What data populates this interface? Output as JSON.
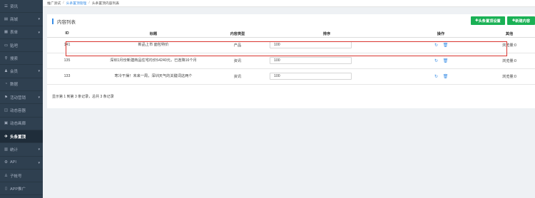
{
  "sidebar": {
    "items": [
      {
        "label": "资讯",
        "icon": "list-icon",
        "has_arrow": false
      },
      {
        "label": "商城",
        "icon": "cart-icon",
        "has_arrow": true
      },
      {
        "label": "表单",
        "icon": "form-icon",
        "has_arrow": true
      },
      {
        "label": "贴吧",
        "icon": "chat-icon",
        "has_arrow": false
      },
      {
        "label": "搜索",
        "icon": "search-icon",
        "has_arrow": false
      },
      {
        "label": "会员",
        "icon": "user-icon",
        "has_arrow": true
      },
      {
        "label": "数据",
        "icon": "chart-icon",
        "has_arrow": false
      },
      {
        "label": "活动营销",
        "icon": "flag-icon",
        "has_arrow": true
      },
      {
        "label": "动态容器",
        "icon": "box-icon",
        "has_arrow": false
      },
      {
        "label": "动态画廊",
        "icon": "gallery-icon",
        "has_arrow": false
      },
      {
        "label": "头条置顶",
        "icon": "plane-icon",
        "has_arrow": false,
        "active": true
      },
      {
        "label": "统计",
        "icon": "stats-icon",
        "has_arrow": true
      },
      {
        "label": "API",
        "icon": "api-icon",
        "has_arrow": true
      },
      {
        "label": "子帐号",
        "icon": "subaccount-icon",
        "has_arrow": false
      },
      {
        "label": "APP推广",
        "icon": "app-icon",
        "has_arrow": false
      }
    ]
  },
  "breadcrumb": {
    "items": [
      "推广测试",
      "头条置顶管理",
      "头条置顶内容列表"
    ],
    "separator": "/"
  },
  "panel": {
    "title": "内容列表",
    "buttons": {
      "settings": "头条置顶设置",
      "new": "新建内容"
    }
  },
  "table": {
    "headers": {
      "id": "ID",
      "title": "标题",
      "type": "内容类型",
      "sort": "排序",
      "actions": "操作",
      "other": "其他"
    },
    "rows": [
      {
        "id": "141",
        "title": "新品上市 面包特价",
        "type": "产品",
        "sort": "100",
        "other": "浏览量:0"
      },
      {
        "id": "135",
        "title": "深圳1月份新建商品住宅均价54240元，已连降16个月",
        "type": "资讯",
        "sort": "100",
        "other": "浏览量:0"
      },
      {
        "id": "133",
        "title": "寒冷干燥！未来一周，深圳天气的关键词这两个",
        "type": "资讯",
        "sort": "100",
        "other": "浏览量:0"
      }
    ]
  },
  "summary": "显示第 1 到第 3 条记录，总共 3 条记录",
  "colors": {
    "sidebar_bg": "#2f4050",
    "accent_green": "#1ab155",
    "accent_blue": "#3a8ee6",
    "highlight_red": "#d9352f"
  }
}
